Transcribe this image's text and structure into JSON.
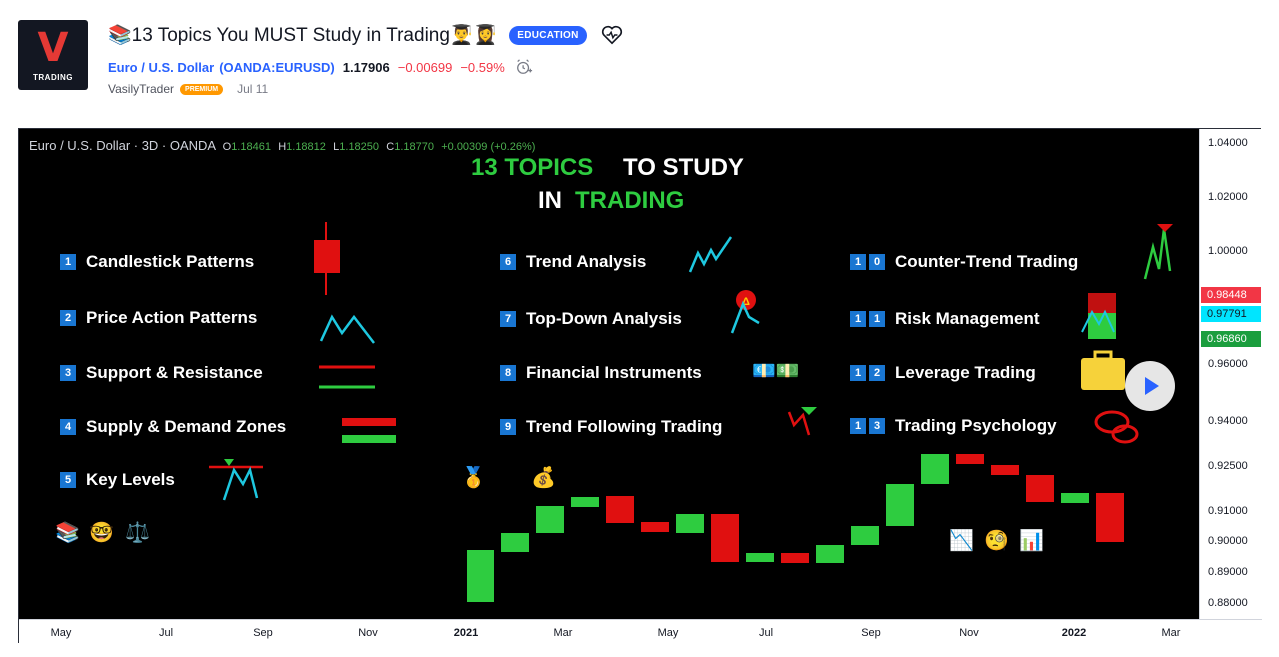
{
  "header": {
    "logo_letter": "V",
    "logo_text": "TRADING",
    "title": "📚13 Topics You MUST Study in Trading👨‍🎓👩‍🎓",
    "badge": "EDUCATION",
    "symbol_name": "Euro / U.S. Dollar",
    "symbol_code": "(OANDA:EURUSD)",
    "price": "1.17906",
    "change": "−0.00699",
    "change_pct": "−0.59%",
    "author": "VasilyTrader",
    "premium": "PREMIUM",
    "date": "Jul 11"
  },
  "chart": {
    "legend_symbol": "Euro / U.S. Dollar · 3D · OANDA",
    "ohlc": [
      {
        "k": "O",
        "v": "1.18461"
      },
      {
        "k": "H",
        "v": "1.18812"
      },
      {
        "k": "L",
        "v": "1.18250"
      },
      {
        "k": "C",
        "v": "1.18770"
      }
    ],
    "change": "+0.00309 (+0.26%)",
    "headline_green_1": "13 TOPICS",
    "headline_white_1": "TO STUDY",
    "headline_white_2": "IN",
    "headline_green_2": "TRADING",
    "colors": {
      "green": "#2ecc40",
      "red": "#e01010",
      "accent": "#2962ff"
    },
    "topics_col1": [
      {
        "num": [
          "1"
        ],
        "label": "Candlestick Patterns"
      },
      {
        "num": [
          "2"
        ],
        "label": "Price Action Patterns"
      },
      {
        "num": [
          "3"
        ],
        "label": "Support & Resistance"
      },
      {
        "num": [
          "4"
        ],
        "label": "Supply & Demand Zones"
      },
      {
        "num": [
          "5"
        ],
        "label": "Key Levels"
      }
    ],
    "topics_col2": [
      {
        "num": [
          "6"
        ],
        "label": "Trend Analysis"
      },
      {
        "num": [
          "7"
        ],
        "label": "Top-Down Analysis"
      },
      {
        "num": [
          "8"
        ],
        "label": "Financial Instruments"
      },
      {
        "num": [
          "9"
        ],
        "label": "Trend Following Trading"
      }
    ],
    "topics_col3": [
      {
        "num": [
          "1",
          "0"
        ],
        "label": "Counter-Trend Trading"
      },
      {
        "num": [
          "1",
          "1"
        ],
        "label": "Risk Management"
      },
      {
        "num": [
          "1",
          "2"
        ],
        "label": "Leverage Trading"
      },
      {
        "num": [
          "1",
          "3"
        ],
        "label": "Trading Psychology"
      }
    ],
    "emojis": {
      "row_left": [
        "📚",
        "🤓",
        "⚖️"
      ],
      "row_mid": [
        "🥇",
        "😎",
        "💰"
      ],
      "row_right": [
        "📉",
        "🧐",
        "📊"
      ],
      "instruments": "💶💵"
    },
    "y_ticks": [
      "1.04000",
      "1.02000",
      "1.00000",
      "0.96000",
      "0.94000",
      "0.92500",
      "0.91000",
      "0.90000",
      "0.89000",
      "0.88000"
    ],
    "y_labels": [
      {
        "text": "0.98448",
        "color": "#f23645"
      },
      {
        "text": "0.97791",
        "color": "#00e5ff"
      },
      {
        "text": "0.96860",
        "color": "#1b9e3e"
      }
    ],
    "x_ticks": [
      "May",
      "Jul",
      "Sep",
      "Nov",
      "2021",
      "Mar",
      "May",
      "Jul",
      "Sep",
      "Nov",
      "2022",
      "Mar"
    ]
  }
}
